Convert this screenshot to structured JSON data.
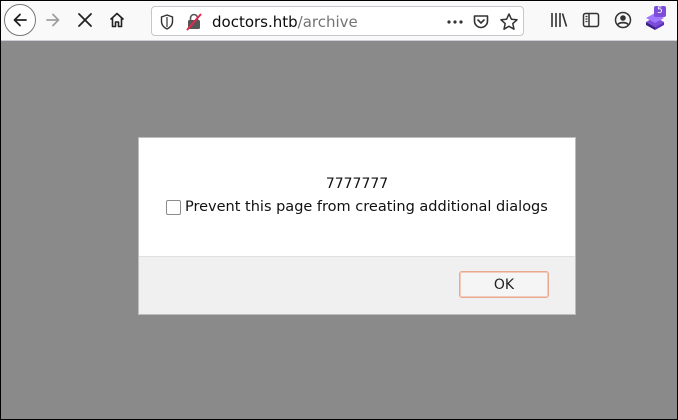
{
  "browser": {
    "url_host": "doctors.htb",
    "url_path": "/archive",
    "extension_badge": "5",
    "icons": [
      "back-icon",
      "forward-icon",
      "stop-icon",
      "home-icon",
      "shield-icon",
      "insecure-lock-icon",
      "more-icon",
      "pocket-icon",
      "bookmark-star-icon",
      "library-icon",
      "sidebar-icon",
      "account-icon",
      "extension-icon"
    ],
    "colors": {
      "content_bg": "#8a8a8a",
      "toolbar_bg": "#f9f9fa",
      "badge": "#7b4dd8",
      "ok_border": "#e8a98f"
    }
  },
  "dialog": {
    "message": "7777777",
    "checkbox_label": "Prevent this page from creating additional dialogs",
    "checkbox_checked": false,
    "ok_label": "OK"
  }
}
